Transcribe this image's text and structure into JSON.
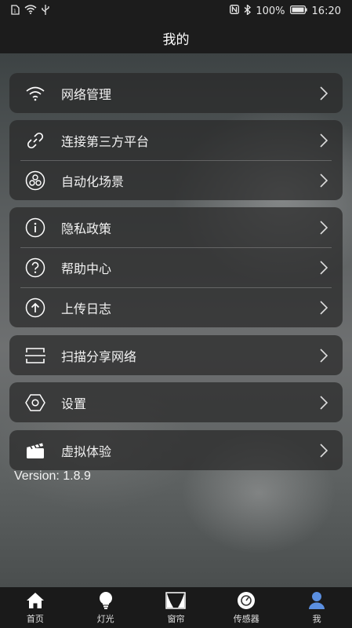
{
  "status": {
    "battery": "100%",
    "time": "16:20"
  },
  "header": {
    "title": "我的"
  },
  "groups": [
    {
      "items": [
        {
          "label": "网络管理",
          "icon": "wifi-icon"
        }
      ]
    },
    {
      "items": [
        {
          "label": "连接第三方平台",
          "icon": "link-icon"
        },
        {
          "label": "自动化场景",
          "icon": "scene-icon"
        }
      ]
    },
    {
      "items": [
        {
          "label": "隐私政策",
          "icon": "info-icon"
        },
        {
          "label": "帮助中心",
          "icon": "help-icon"
        },
        {
          "label": "上传日志",
          "icon": "upload-icon"
        }
      ]
    },
    {
      "items": [
        {
          "label": "扫描分享网络",
          "icon": "scan-icon"
        }
      ]
    },
    {
      "items": [
        {
          "label": "设置",
          "icon": "settings-icon"
        }
      ]
    },
    {
      "items": [
        {
          "label": "虚拟体验",
          "icon": "clapper-icon"
        }
      ]
    }
  ],
  "version": "Version: 1.8.9",
  "tabs": [
    {
      "label": "首页",
      "icon": "home-icon"
    },
    {
      "label": "灯光",
      "icon": "bulb-icon"
    },
    {
      "label": "窗帘",
      "icon": "curtain-icon"
    },
    {
      "label": "传感器",
      "icon": "sensor-icon"
    },
    {
      "label": "我",
      "icon": "user-icon",
      "active": true
    }
  ],
  "colors": {
    "active_tab": "#5b8fe0",
    "panel": "#282828"
  }
}
